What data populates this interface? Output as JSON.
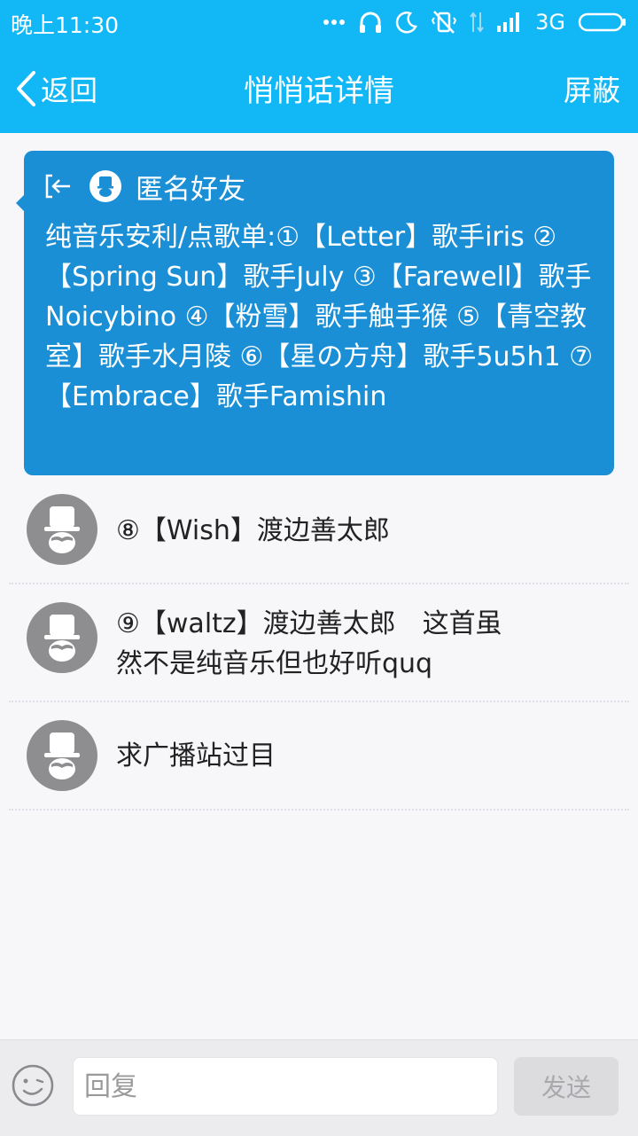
{
  "status_bar": {
    "time": "晚上11:30",
    "network": "3G",
    "icons": [
      "dots-icon",
      "headphones-icon",
      "moon-icon",
      "vibrate-off-icon",
      "data-arrows-icon",
      "signal-icon",
      "battery-icon"
    ]
  },
  "nav": {
    "back_label": "返回",
    "title": "悄悄话详情",
    "block_label": "屏蔽",
    "color": "#12b7f5"
  },
  "post": {
    "author": "匿名好友",
    "text": "纯音乐安利/点歌单:①【Letter】歌手iris ②【Spring Sun】歌手July ③【Farewell】歌手Noicybino ④【粉雪】歌手触手猴 ⑤【青空教室】歌手水月陵 ⑥【星の方舟】歌手5u5h1 ⑦【Embrace】歌手Famishin",
    "card_color": "#1a8fd6"
  },
  "replies": [
    {
      "text": "⑧【Wish】渡边善太郎"
    },
    {
      "text": "⑨【waltz】渡边善太郎　这首虽然不是纯音乐但也好听quq"
    },
    {
      "text": "求广播站过目"
    }
  ],
  "input_bar": {
    "placeholder": "回复",
    "send_label": "发送"
  }
}
